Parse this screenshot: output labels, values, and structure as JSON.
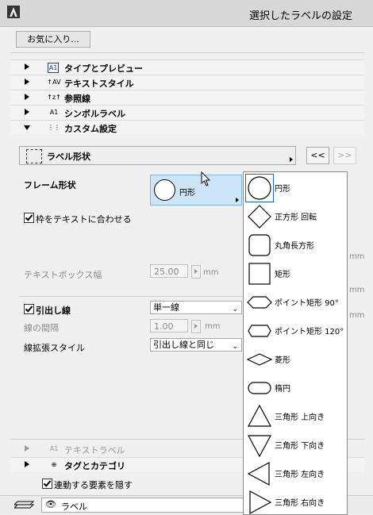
{
  "window": {
    "title": "選択したラベルの設定"
  },
  "toolbar": {
    "favorites_label": "お気に入り..."
  },
  "sections": [
    {
      "label": "タイプとプレビュー",
      "icon": "A1"
    },
    {
      "label": "テキストスタイル",
      "icon": "↑AV"
    },
    {
      "label": "参照線",
      "icon": "↑z↑"
    },
    {
      "label": "シンボルラベル",
      "icon": "A1"
    },
    {
      "label": "カスタム設定",
      "icon": "⋮⋮"
    }
  ],
  "custom": {
    "dropdown_label": "ラベル形状",
    "prev_label": "<<",
    "next_label": ">>",
    "frame_shape_label": "フレーム形状",
    "frame_shape_value": "円形",
    "fit_frame_label": "枠をテキストに合わせる",
    "textbox_width_label": "テキストボックス幅",
    "textbox_width_value": "25.00",
    "unit_mm": "mm",
    "leader_label": "引出し線",
    "leader_type": "単一線",
    "line_spacing_label": "線の間隔",
    "line_spacing_value": "1.00",
    "line_ext_label": "線拡張スタイル",
    "line_ext_value": "引出し線と同じ"
  },
  "lower_sections": [
    {
      "label": "テキストラベル"
    },
    {
      "label": "タグとカテゴリ"
    }
  ],
  "hide_linked_label": "連動する要素を隠す",
  "bottom": {
    "layer_label": "ラベル"
  },
  "popup": {
    "items": [
      {
        "label": "円形",
        "icon": "circle-icon"
      },
      {
        "label": "正方形 回転",
        "icon": "diamond-square-icon"
      },
      {
        "label": "丸角長方形",
        "icon": "rounded-rect-icon"
      },
      {
        "label": "矩形",
        "icon": "rect-icon"
      },
      {
        "label": "ポイント矩形 90°",
        "icon": "point-rect-90-icon"
      },
      {
        "label": "ポイント矩形 120°",
        "icon": "point-rect-120-icon"
      },
      {
        "label": "菱形",
        "icon": "rhombus-icon"
      },
      {
        "label": "楕円",
        "icon": "ellipse-icon"
      },
      {
        "label": "三角形 上向き",
        "icon": "triangle-up-icon"
      },
      {
        "label": "三角形 下向き",
        "icon": "triangle-down-icon"
      },
      {
        "label": "三角形 左向き",
        "icon": "triangle-left-icon"
      },
      {
        "label": "三角形 右向き",
        "icon": "triangle-right-icon"
      }
    ]
  }
}
